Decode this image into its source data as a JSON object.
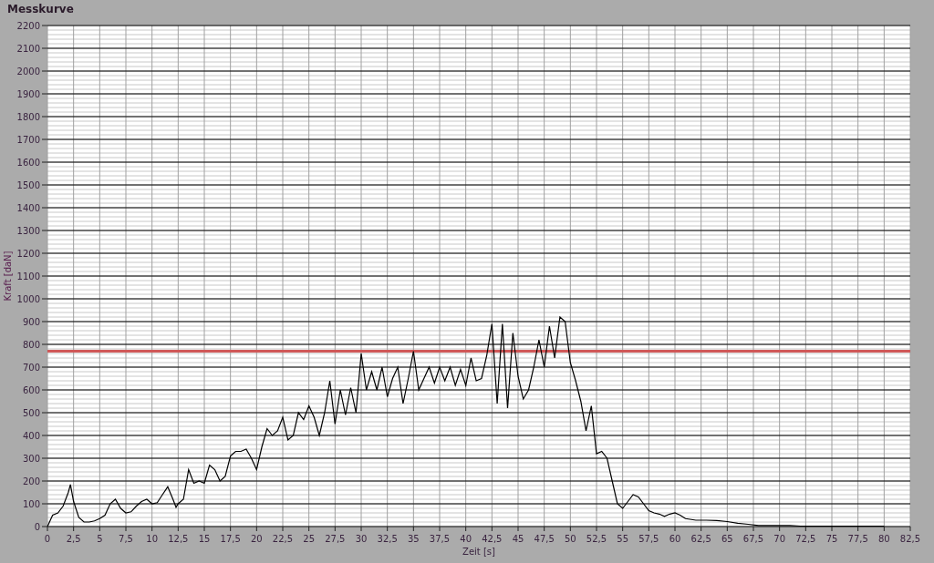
{
  "title": "Messkurve",
  "chart": {
    "chart_data": {
      "type": "line",
      "xlabel": "Zeit [s]",
      "ylabel": "Kraft [daN]",
      "x": [
        0,
        0.5,
        1,
        1.5,
        2,
        2.2,
        2.5,
        3,
        3.5,
        4,
        4.5,
        5,
        5.5,
        6,
        6.5,
        7,
        7.5,
        8,
        8.5,
        9,
        9.5,
        10,
        10.5,
        11,
        11.5,
        12,
        12.3,
        12.5,
        13,
        13.5,
        14,
        14.5,
        15,
        15.5,
        16,
        16.5,
        17,
        17.5,
        18,
        18.5,
        19,
        19.5,
        20,
        20.5,
        21,
        21.5,
        22,
        22.5,
        23,
        23.5,
        24,
        24.5,
        25,
        25.5,
        26,
        26.5,
        27,
        27.5,
        28,
        28.5,
        29,
        29.5,
        30,
        30.5,
        31,
        31.5,
        32,
        32.5,
        33,
        33.5,
        34,
        34.5,
        35,
        35.5,
        36,
        36.5,
        37,
        37.5,
        38,
        38.5,
        39,
        39.5,
        40,
        40.5,
        41,
        41.5,
        42,
        42.5,
        43,
        43.5,
        44,
        44.5,
        45,
        45.5,
        46,
        46.5,
        47,
        47.5,
        48,
        48.5,
        49,
        49.5,
        50,
        50.5,
        51,
        51.5,
        52,
        52.5,
        53,
        53.5,
        54,
        54.5,
        55,
        55.5,
        56,
        56.5,
        57,
        57.5,
        58,
        58.5,
        59,
        59.5,
        60,
        60.5,
        61,
        62,
        63,
        64,
        65,
        66,
        67,
        68,
        69,
        70,
        71,
        72,
        80
      ],
      "series": [
        {
          "color": "#000000",
          "values": [
            0,
            50,
            60,
            90,
            150,
            185,
            110,
            40,
            20,
            20,
            25,
            35,
            50,
            100,
            120,
            80,
            60,
            65,
            90,
            110,
            120,
            100,
            105,
            140,
            175,
            120,
            85,
            100,
            120,
            250,
            190,
            200,
            190,
            270,
            250,
            200,
            220,
            310,
            330,
            330,
            340,
            300,
            250,
            350,
            430,
            400,
            420,
            480,
            380,
            400,
            500,
            470,
            530,
            480,
            400,
            500,
            640,
            450,
            600,
            490,
            610,
            500,
            760,
            600,
            680,
            600,
            700,
            570,
            650,
            700,
            540,
            650,
            770,
            600,
            650,
            700,
            630,
            700,
            640,
            700,
            620,
            690,
            620,
            740,
            640,
            650,
            750,
            890,
            540,
            890,
            520,
            850,
            660,
            560,
            600,
            700,
            820,
            700,
            880,
            740,
            920,
            900,
            720,
            640,
            550,
            420,
            530,
            320,
            330,
            300,
            200,
            100,
            80,
            110,
            140,
            130,
            100,
            70,
            60,
            55,
            45,
            55,
            60,
            50,
            35,
            28,
            28,
            27,
            22,
            15,
            10,
            5,
            5,
            5,
            5,
            2,
            2
          ]
        }
      ],
      "xlim": [
        0,
        82.5
      ],
      "ylim": [
        0,
        2200
      ],
      "xticks": [
        0,
        {
          "value": 2.5,
          "label": "2,5"
        },
        5,
        {
          "value": 7.5,
          "label": "7,5"
        },
        10,
        {
          "value": 12.5,
          "label": "12,5"
        },
        15,
        {
          "value": 17.5,
          "label": "17,5"
        },
        20,
        {
          "value": 22.5,
          "label": "22,5"
        },
        25,
        {
          "value": 27.5,
          "label": "27,5"
        },
        30,
        {
          "value": 32.5,
          "label": "32,5"
        },
        35,
        {
          "value": 37.5,
          "label": "37,5"
        },
        40,
        {
          "value": 42.5,
          "label": "42,5"
        },
        45,
        {
          "value": 47.5,
          "label": "47,5"
        },
        50,
        {
          "value": 52.5,
          "label": "52,5"
        },
        55,
        {
          "value": 57.5,
          "label": "57,5"
        },
        60,
        {
          "value": 62.5,
          "label": "62,5"
        },
        65,
        {
          "value": 67.5,
          "label": "67,5"
        },
        70,
        {
          "value": 72.5,
          "label": "72,5"
        },
        75,
        {
          "value": 77.5,
          "label": "77,5"
        },
        80,
        {
          "value": 82.5,
          "label": "82,5"
        }
      ],
      "yticks": [
        0,
        100,
        200,
        300,
        400,
        500,
        600,
        700,
        800,
        900,
        1000,
        1100,
        1200,
        1300,
        1400,
        1500,
        1600,
        1700,
        1800,
        1900,
        2000,
        2100,
        2200
      ],
      "grid": true,
      "ref_lines": [
        {
          "axis": "y",
          "value": 770,
          "color": "#d05858"
        }
      ]
    }
  }
}
